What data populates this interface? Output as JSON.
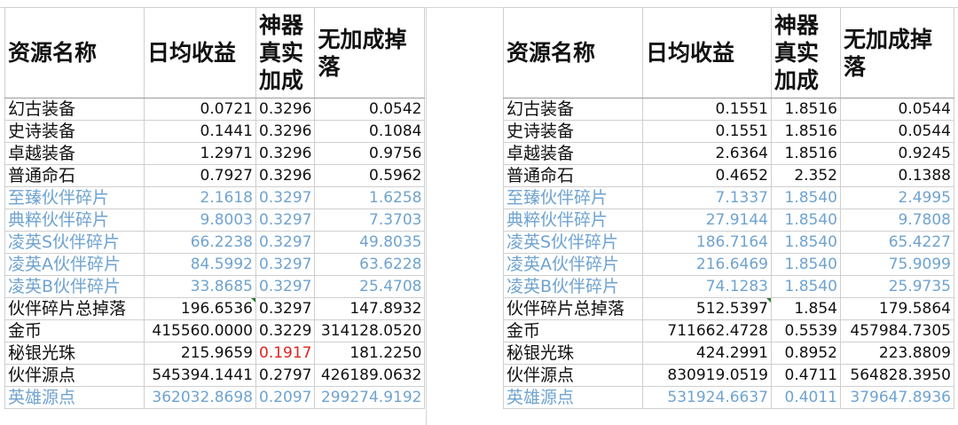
{
  "left_table": {
    "headers": [
      "资源名称",
      "日均收益",
      "神器真实加成",
      "无加成掉落"
    ],
    "rows": [
      {
        "name": "幻古装备",
        "daily": "0.0721",
        "bonus": "0.3296",
        "drop": "0.0542",
        "blue": false
      },
      {
        "name": "史诗装备",
        "daily": "0.1441",
        "bonus": "0.3296",
        "drop": "0.1084",
        "blue": false
      },
      {
        "name": "卓越装备",
        "daily": "1.2971",
        "bonus": "0.3296",
        "drop": "0.9756",
        "blue": false
      },
      {
        "name": "普通命石",
        "daily": "0.7927",
        "bonus": "0.3296",
        "drop": "0.5962",
        "blue": false
      },
      {
        "name": "至臻伙伴碎片",
        "daily": "2.1618",
        "bonus": "0.3297",
        "drop": "1.6258",
        "blue": true
      },
      {
        "name": "典粹伙伴碎片",
        "daily": "9.8003",
        "bonus": "0.3297",
        "drop": "7.3703",
        "blue": true
      },
      {
        "name": "凌英S伙伴碎片",
        "daily": "66.2238",
        "bonus": "0.3297",
        "drop": "49.8035",
        "blue": true
      },
      {
        "name": "凌英A伙伴碎片",
        "daily": "84.5992",
        "bonus": "0.3297",
        "drop": "63.6228",
        "blue": true
      },
      {
        "name": "凌英B伙伴碎片",
        "daily": "33.8685",
        "bonus": "0.3297",
        "drop": "25.4708",
        "blue": true
      },
      {
        "name": "伙伴碎片总掉落",
        "daily": "196.6536",
        "bonus": "0.3297",
        "drop": "147.8932",
        "blue": false
      },
      {
        "name": "金币",
        "daily": "415560.0000",
        "bonus": "0.3229",
        "drop": "314128.0520",
        "blue": false
      },
      {
        "name": "秘银光珠",
        "daily": "215.9659",
        "bonus": "0.1917",
        "drop": "181.2250",
        "blue": false
      },
      {
        "name": "伙伴源点",
        "daily": "545394.1441",
        "bonus": "0.2797",
        "drop": "426189.0632",
        "blue": false
      },
      {
        "name": "英雄源点",
        "daily": "362032.8698",
        "bonus": "0.2097",
        "drop": "299274.9192",
        "blue": true
      }
    ]
  },
  "right_table": {
    "headers": [
      "资源名称",
      "日均收益",
      "神器真实加成",
      "无加成掉落"
    ],
    "rows": [
      {
        "name": "幻古装备",
        "daily": "0.1551",
        "bonus": "1.8516",
        "drop": "0.0544",
        "blue": false
      },
      {
        "name": "史诗装备",
        "daily": "0.1551",
        "bonus": "1.8516",
        "drop": "0.0544",
        "blue": false
      },
      {
        "name": "卓越装备",
        "daily": "2.6364",
        "bonus": "1.8516",
        "drop": "0.9245",
        "blue": false
      },
      {
        "name": "普通命石",
        "daily": "0.4652",
        "bonus": "2.352",
        "drop": "0.1388",
        "blue": false
      },
      {
        "name": "至臻伙伴碎片",
        "daily": "7.1337",
        "bonus": "1.8540",
        "drop": "2.4995",
        "blue": true
      },
      {
        "name": "典粹伙伴碎片",
        "daily": "27.9144",
        "bonus": "1.8540",
        "drop": "9.7808",
        "blue": true
      },
      {
        "name": "凌英S伙伴碎片",
        "daily": "186.7164",
        "bonus": "1.8540",
        "drop": "65.4227",
        "blue": true
      },
      {
        "name": "凌英A伙伴碎片",
        "daily": "216.6469",
        "bonus": "1.8540",
        "drop": "75.9099",
        "blue": true
      },
      {
        "name": "凌英B伙伴碎片",
        "daily": "74.1283",
        "bonus": "1.8540",
        "drop": "25.9735",
        "blue": true
      },
      {
        "name": "伙伴碎片总掉落",
        "daily": "512.5397",
        "bonus": "1.854",
        "drop": "179.5864",
        "blue": false
      },
      {
        "name": "金币",
        "daily": "711662.4728",
        "bonus": "0.5539",
        "drop": "457984.7305",
        "blue": false
      },
      {
        "name": "秘银光珠",
        "daily": "424.2991",
        "bonus": "0.8952",
        "drop": "223.8809",
        "blue": false
      },
      {
        "name": "伙伴源点",
        "daily": "830919.0519",
        "bonus": "0.4711",
        "drop": "564828.3950",
        "blue": false
      },
      {
        "name": "英雄源点",
        "daily": "531924.6637",
        "bonus": "0.4011",
        "drop": "379647.8936",
        "blue": true
      }
    ]
  },
  "colors": {
    "blue_text": "#6fa3d0",
    "red_text": "#e0231b",
    "comment_marker": "#2e7d32"
  }
}
